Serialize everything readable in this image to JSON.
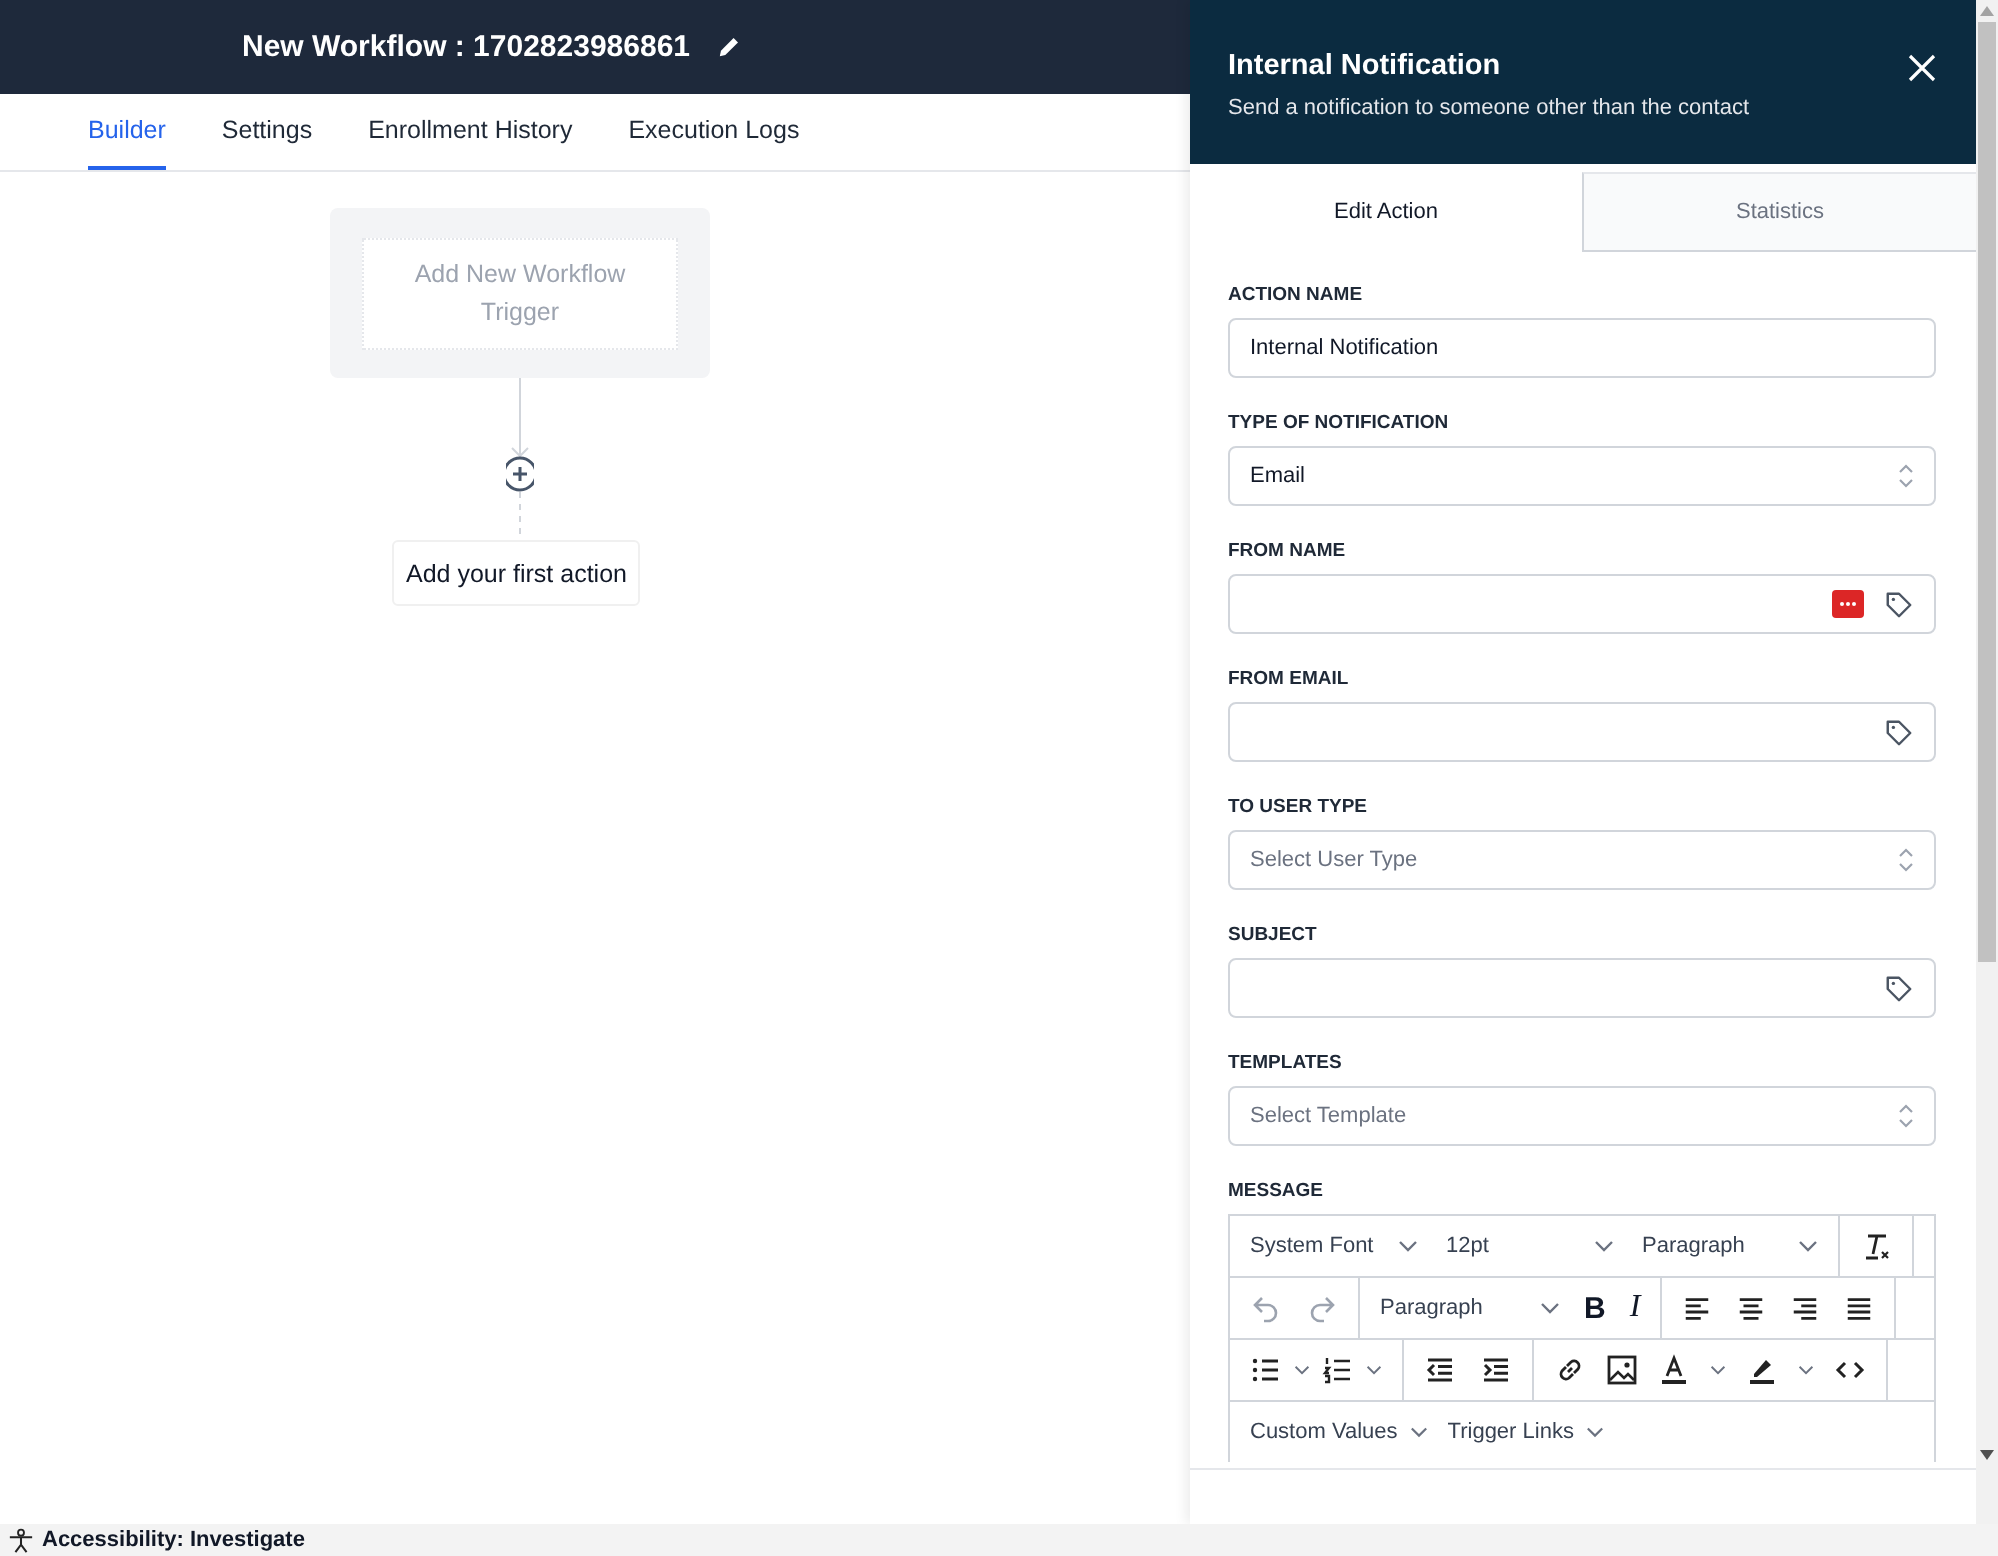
{
  "header": {
    "title": "New Workflow : 1702823986861"
  },
  "tabs": [
    {
      "label": "Builder",
      "selected": true
    },
    {
      "label": "Settings",
      "selected": false
    },
    {
      "label": "Enrollment History",
      "selected": false
    },
    {
      "label": "Execution Logs",
      "selected": false
    }
  ],
  "canvas": {
    "trigger": "Add New Workflow Trigger",
    "first_action": "Add your first action"
  },
  "panel": {
    "title": "Internal Notification",
    "subtitle": "Send a notification to someone other than the contact",
    "tabs": [
      {
        "label": "Edit Action",
        "selected": true
      },
      {
        "label": "Statistics",
        "selected": false
      }
    ],
    "fields": [
      {
        "label": "ACTION NAME",
        "kind": "text",
        "value": "Internal Notification"
      },
      {
        "label": "TYPE OF NOTIFICATION",
        "kind": "select",
        "value": "Email"
      },
      {
        "label": "FROM NAME",
        "kind": "tag-more"
      },
      {
        "label": "FROM EMAIL",
        "kind": "tag"
      },
      {
        "label": "TO USER TYPE",
        "kind": "select",
        "placeholder": "Select User Type"
      },
      {
        "label": "SUBJECT",
        "kind": "tag"
      },
      {
        "label": "TEMPLATES",
        "kind": "select",
        "placeholder": "Select Template"
      }
    ],
    "message": {
      "label": "MESSAGE",
      "font": "System Font",
      "size": "12pt",
      "format": "Paragraph",
      "block": "Paragraph",
      "bold": "B",
      "italic": "I",
      "menus": [
        "Custom Values",
        "Trigger Links"
      ]
    }
  },
  "status_bar": {
    "text": "Accessibility: Investigate"
  }
}
